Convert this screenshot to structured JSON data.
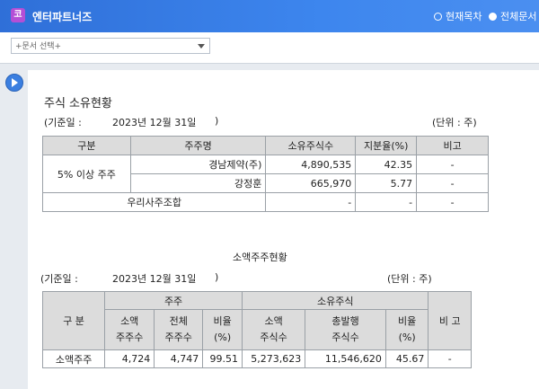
{
  "header": {
    "logo_glyph": "코",
    "app_title": "엔터파트너즈",
    "radio_current": "현재목차",
    "radio_all": "전체문서"
  },
  "toolbar": {
    "doc_select_placeholder": "+문서 선택+"
  },
  "document": {
    "title": "주식 소유현황",
    "base_label": "(기준일 :",
    "base_date": "2023년 12월 31일",
    "close_paren": ")",
    "unit": "(단위 : 주)",
    "table1": {
      "headers": [
        "구분",
        "주주명",
        "소유주식수",
        "지분율(%)",
        "비고"
      ],
      "group_label": "5% 이상 주주",
      "rows": [
        {
          "name": "경남제약(주)",
          "shares": "4,890,535",
          "ratio": "42.35",
          "note": "-"
        },
        {
          "name": "강정훈",
          "shares": "665,970",
          "ratio": "5.77",
          "note": "-"
        }
      ],
      "union_row": {
        "label": "우리사주조합",
        "shares": "-",
        "ratio": "-",
        "note": "-"
      }
    },
    "minor": {
      "title": "소액주주현황",
      "base_label": "(기준일 :",
      "base_date": "2023년 12월 31일",
      "close_paren": ")",
      "unit": "(단위 : 주)",
      "head_division": "구 분",
      "head_shareholders": "주주",
      "head_ownership": "소유주식",
      "head_note": "비 고",
      "sub_minor_count_1": "소액",
      "sub_minor_count_2": "주주수",
      "sub_total_count_1": "전체",
      "sub_total_count_2": "주주수",
      "sub_ratio_1": "비율",
      "sub_ratio_2": "(%)",
      "sub_minor_shares_1": "소액",
      "sub_minor_shares_2": "주식수",
      "sub_total_shares_1": "총발행",
      "sub_total_shares_2": "주식수",
      "sub_ratio2_1": "비율",
      "sub_ratio2_2": "(%)",
      "row": {
        "label": "소액주주",
        "minor_count": "4,724",
        "total_count": "4,747",
        "count_ratio": "99.51",
        "minor_shares": "5,273,623",
        "total_shares": "11,546,620",
        "share_ratio": "45.67",
        "note": "-"
      }
    }
  }
}
